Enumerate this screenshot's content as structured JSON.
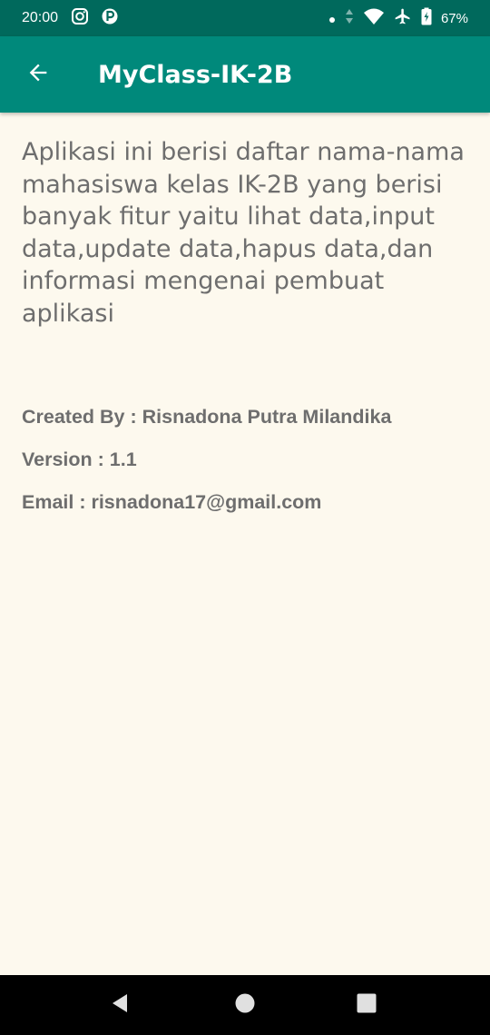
{
  "status_bar": {
    "time": "20:00",
    "battery": "67%",
    "icons": [
      "instagram-icon",
      "p-app-icon",
      "dot-icon",
      "data-arrows-icon",
      "wifi-icon",
      "airplane-mode-icon",
      "battery-charging-icon"
    ]
  },
  "app_bar": {
    "title": "MyClass-IK-2B",
    "back_icon": "arrow-left-icon"
  },
  "content": {
    "description": "Aplikasi ini berisi daftar nama-nama mahasiswa kelas IK-2B yang berisi banyak fitur yaitu lihat data,input data,update data,hapus data,dan informasi mengenai pembuat aplikasi",
    "created_by": "Created By : Risnadona Putra Milandika",
    "version": "Version : 1.1",
    "email": "Email : risnadona17@gmail.com"
  },
  "nav_bar": {
    "icons": [
      "back-triangle-icon",
      "home-circle-icon",
      "recents-square-icon"
    ]
  },
  "colors": {
    "status_bar": "#00695C",
    "app_bar": "#00897B",
    "background": "#FDF9EE",
    "text": "#6E6E6E"
  }
}
